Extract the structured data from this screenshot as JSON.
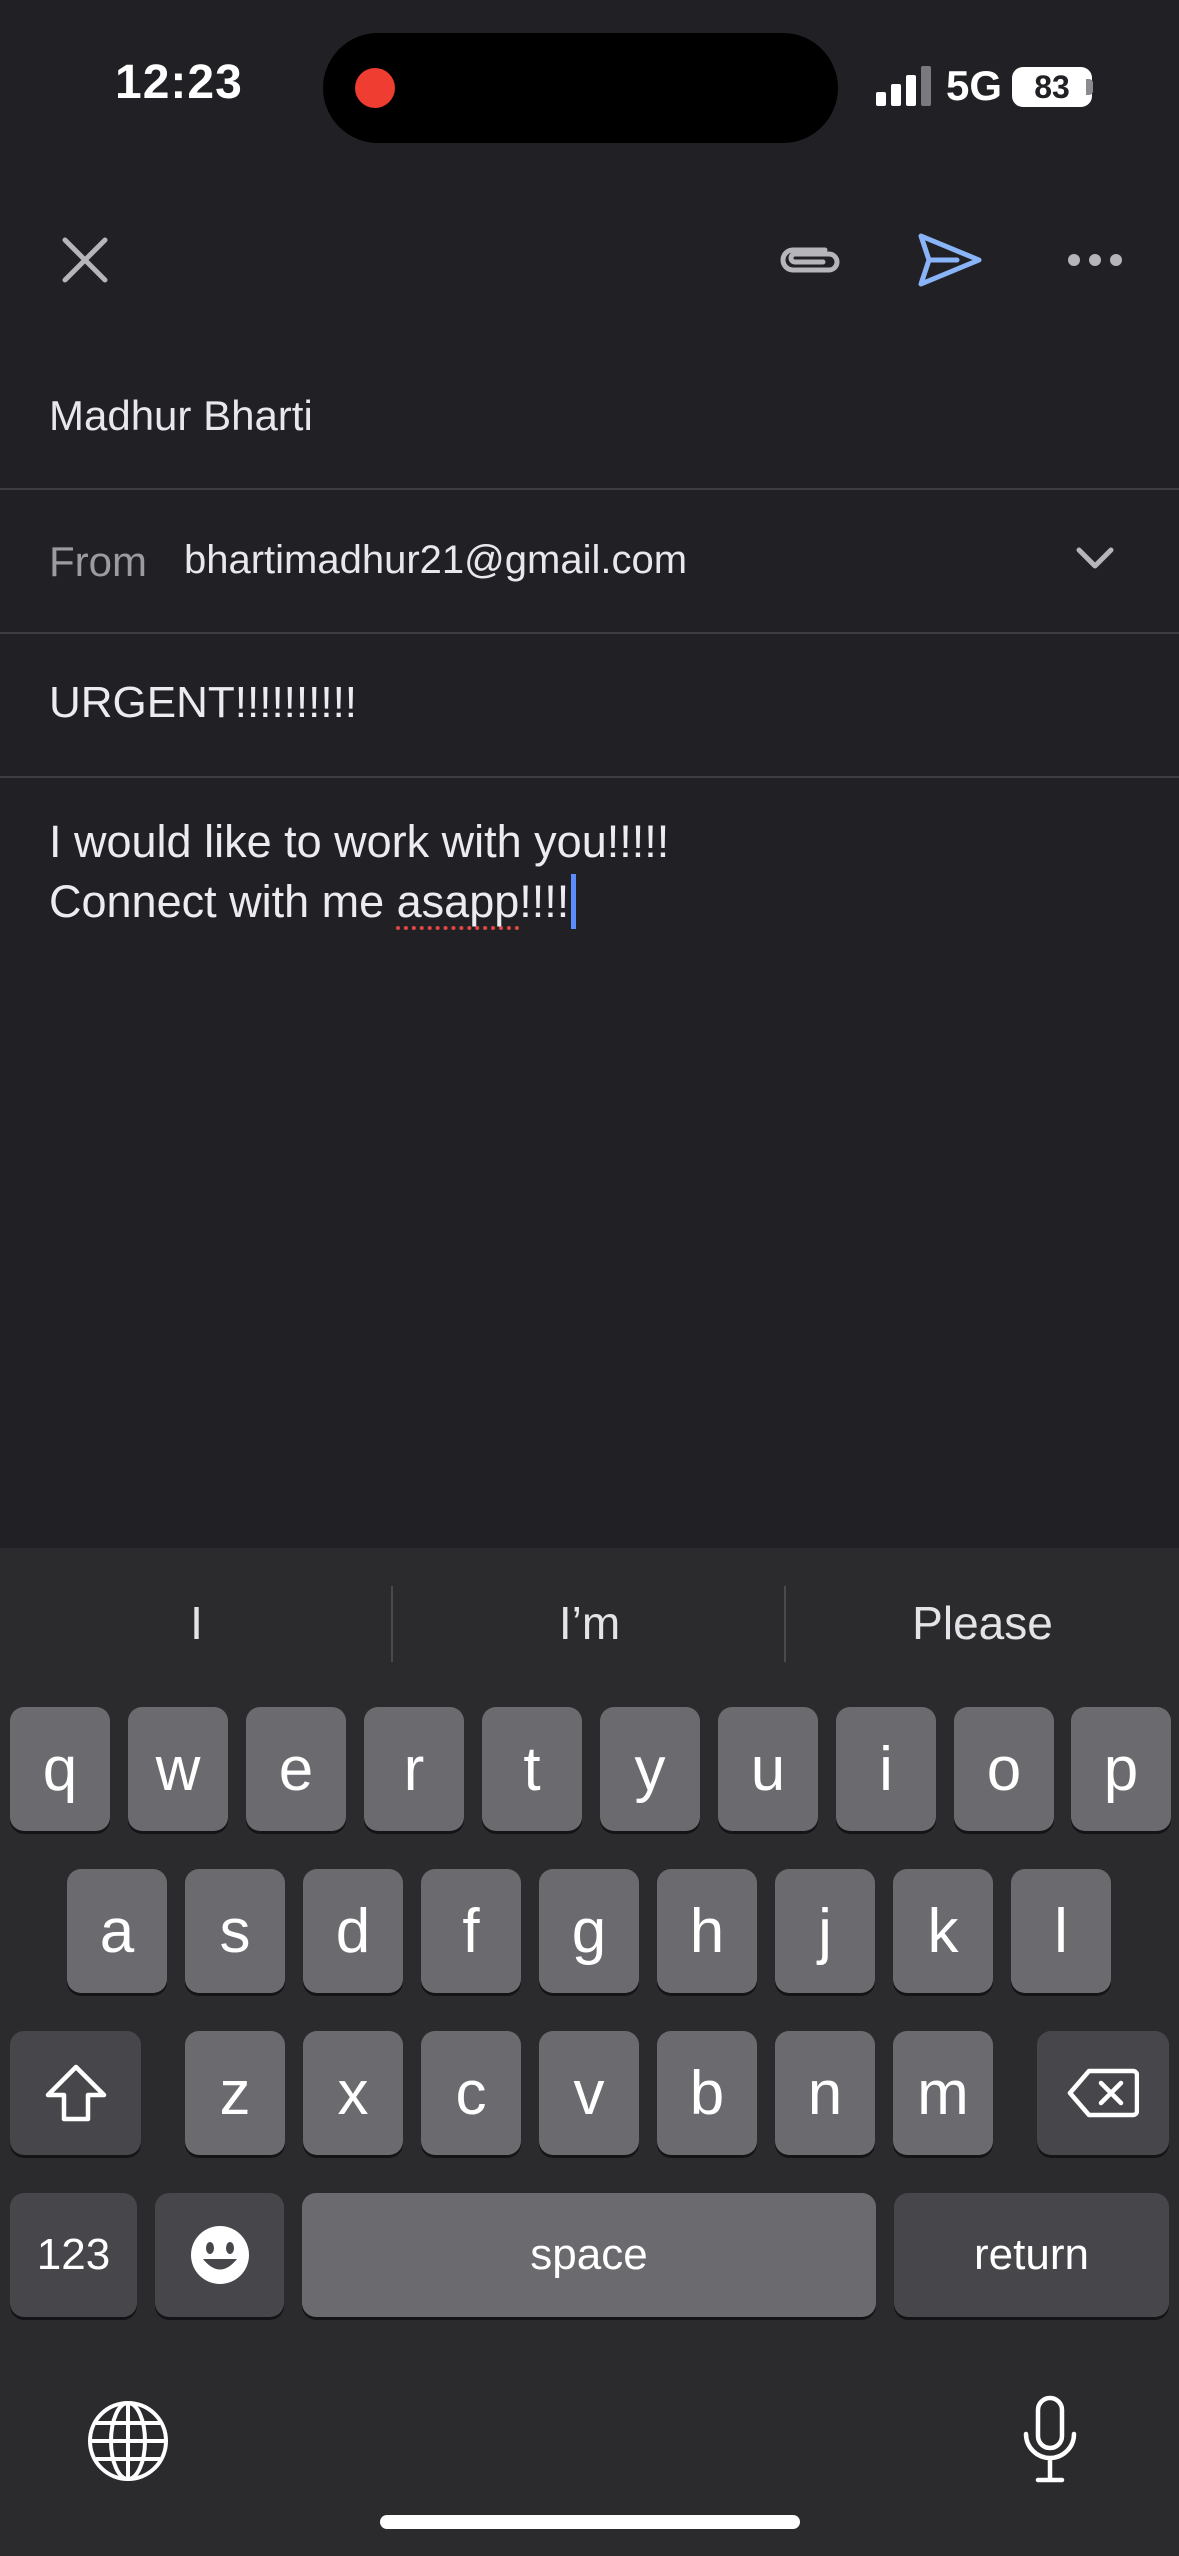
{
  "status_bar": {
    "time": "12:23",
    "network": "5G",
    "battery": "83"
  },
  "toolbar": {
    "close_icon": "close-icon",
    "attach_icon": "paperclip-icon",
    "send_icon": "send-icon",
    "more_icon": "more-dots-icon",
    "send_color": "#8ab4f8"
  },
  "compose": {
    "to": "Madhur Bharti",
    "from_label": "From",
    "from_value": "bhartimadhur21@gmail.com",
    "subject": "URGENT!!!!!!!!!!",
    "body_line1": "I would like to work with you!!!!!",
    "body_line2_prefix": "Connect with me ",
    "body_line2_misspelled": "asapp",
    "body_line2_suffix": "!!!!"
  },
  "keyboard": {
    "suggestions": [
      "I",
      "I’m",
      "Please"
    ],
    "row1": [
      "q",
      "w",
      "e",
      "r",
      "t",
      "y",
      "u",
      "i",
      "o",
      "p"
    ],
    "row2": [
      "a",
      "s",
      "d",
      "f",
      "g",
      "h",
      "j",
      "k",
      "l"
    ],
    "row3": [
      "z",
      "x",
      "c",
      "v",
      "b",
      "n",
      "m"
    ],
    "numbers_label": "123",
    "space_label": "space",
    "return_label": "return"
  }
}
